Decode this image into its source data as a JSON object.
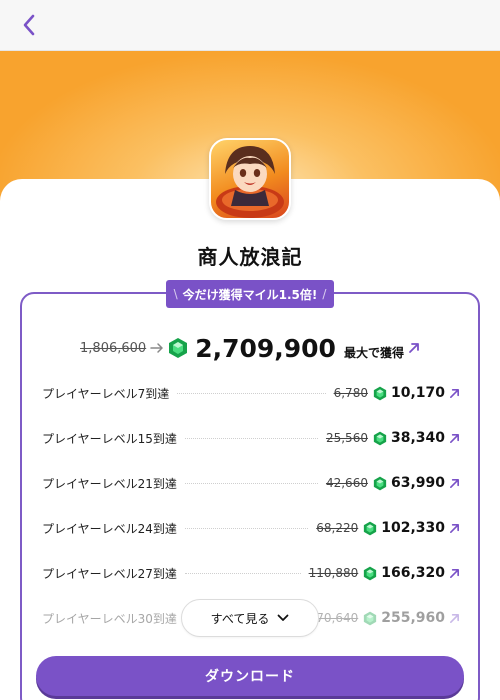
{
  "app": {
    "title": "商人放浪記"
  },
  "colors": {
    "accent": "#7a52c7",
    "gem": "#22c55e",
    "hero_orange": "#f8a32e"
  },
  "promo": {
    "prefix": "\\",
    "label": "今だけ獲得マイル1.5倍!",
    "suffix": "/"
  },
  "summary": {
    "old_total": "1,806,600",
    "new_total": "2,709,900",
    "max_label": "最大で獲得"
  },
  "rows": [
    {
      "label": "プレイヤーレベル7到達",
      "old": "6,780",
      "new": "10,170"
    },
    {
      "label": "プレイヤーレベル15到達",
      "old": "25,560",
      "new": "38,340"
    },
    {
      "label": "プレイヤーレベル21到達",
      "old": "42,660",
      "new": "63,990"
    },
    {
      "label": "プレイヤーレベル24到達",
      "old": "68,220",
      "new": "102,330"
    },
    {
      "label": "プレイヤーレベル27到達",
      "old": "110,880",
      "new": "166,320"
    },
    {
      "label": "プレイヤーレベル30到達",
      "old": "170,640",
      "new": "255,960"
    }
  ],
  "see_all": {
    "label": "すべて見る"
  },
  "download": {
    "label": "ダウンロード"
  },
  "icons": {
    "back": "chevron-left-icon",
    "gem": "emerald-gem-icon",
    "external": "arrow-up-right-icon",
    "expand": "chevron-down-icon"
  }
}
